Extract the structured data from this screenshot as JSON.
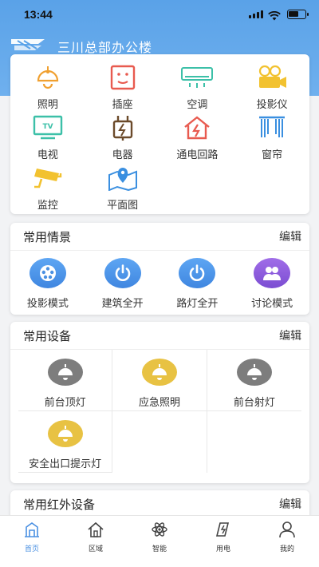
{
  "status_bar": {
    "time": "13:44"
  },
  "header": {
    "title": "三川总部办公楼"
  },
  "categories": [
    {
      "label": "照明",
      "icon": "ceiling-lamp-icon"
    },
    {
      "label": "插座",
      "icon": "socket-icon"
    },
    {
      "label": "空调",
      "icon": "air-conditioner-icon"
    },
    {
      "label": "投影仪",
      "icon": "projector-icon"
    },
    {
      "label": "电视",
      "icon": "tv-icon"
    },
    {
      "label": "电器",
      "icon": "appliance-plug-icon"
    },
    {
      "label": "通电回路",
      "icon": "power-circuit-icon"
    },
    {
      "label": "窗帘",
      "icon": "curtain-icon"
    },
    {
      "label": "监控",
      "icon": "camera-icon"
    },
    {
      "label": "平面图",
      "icon": "map-icon"
    }
  ],
  "scenes": {
    "title": "常用情景",
    "edit": "编辑",
    "items": [
      {
        "label": "投影模式",
        "icon": "film-reel-icon"
      },
      {
        "label": "建筑全开",
        "icon": "power-icon"
      },
      {
        "label": "路灯全开",
        "icon": "power-icon"
      },
      {
        "label": "讨论模式",
        "icon": "group-icon"
      }
    ]
  },
  "devices": {
    "title": "常用设备",
    "edit": "编辑",
    "items": [
      {
        "label": "前台顶灯",
        "state": "off"
      },
      {
        "label": "应急照明",
        "state": "on"
      },
      {
        "label": "前台射灯",
        "state": "off"
      },
      {
        "label": "安全出口提示灯",
        "state": "on"
      }
    ]
  },
  "ir_devices": {
    "title": "常用红外设备",
    "edit": "编辑"
  },
  "tabs": [
    {
      "label": "首页",
      "icon": "home-building-icon",
      "active": true
    },
    {
      "label": "区域",
      "icon": "house-icon",
      "active": false
    },
    {
      "label": "智能",
      "icon": "atom-icon",
      "active": false
    },
    {
      "label": "用电",
      "icon": "energy-icon",
      "active": false
    },
    {
      "label": "我的",
      "icon": "user-icon",
      "active": false
    }
  ],
  "colors": {
    "header_blue": "#5aa2e8",
    "orange": "#f0a030",
    "red": "#e85a4f",
    "teal": "#3cc0a8",
    "yellow": "#f2c230",
    "blue": "#3a8fe0",
    "purple": "#8a5bd8",
    "lamp_off": "#7d7d7d",
    "lamp_on": "#e8c243",
    "tab_active": "#4a90e2"
  }
}
